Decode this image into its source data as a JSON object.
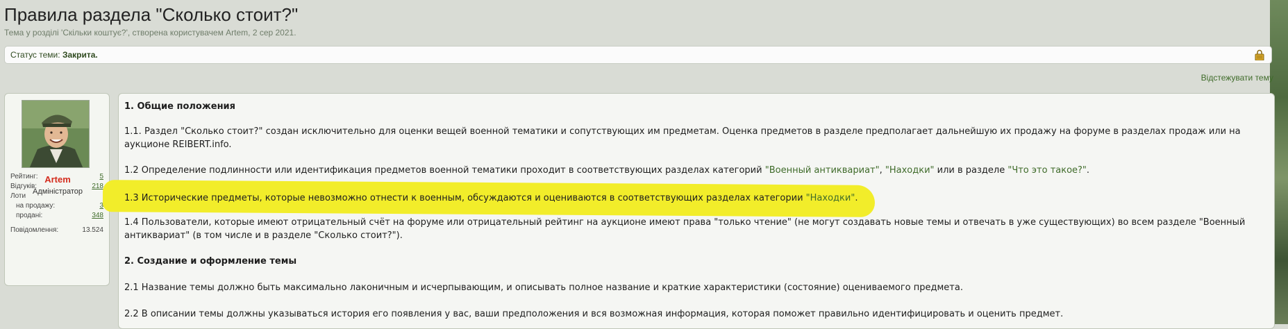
{
  "header": {
    "title": "Правила раздела \"Сколько стоит?\"",
    "subtitle": "Тема у розділі 'Скільки коштує?', створена користувачем Artem, 2 сер 2021."
  },
  "status": {
    "label": "Статус теми:",
    "value": "Закрита."
  },
  "watch_link": "Відстежувати тему",
  "user": {
    "name": "Artem",
    "role": "Адміністратор",
    "stats": {
      "rating_label": "Рейтинг:",
      "rating_value": "5",
      "reviews_label": "Відгуків:",
      "reviews_value": "218",
      "lots_label": "Лоти",
      "on_sale_label": "на продажу:",
      "on_sale_value": "3",
      "sold_label": "продані:",
      "sold_value": "348",
      "messages_label": "Повідомлення:",
      "messages_value": "13.524"
    }
  },
  "post": {
    "h1": "1. Общие положения",
    "p1_1a": "1.1. Раздел \"Сколько стоит?\" создан исключительно для оценки вещей военной тематики и сопутствующих им предметам. Оценка предметов в разделе предполагает дальнейшую их продажу на форуме в разделах продаж или на",
    "p1_1b": "аукционе REIBERT.info.",
    "p1_2_pre": "1.2 Определение подлинности или идентификация предметов военной тематики проходит в соответствующих разделах категорий ",
    "p1_2_link1": "\"Военный антиквариат\"",
    "p1_2_mid": ", ",
    "p1_2_link2": "\"Находки\"",
    "p1_2_mid2": " или в разделе ",
    "p1_2_link3": "\"Что это такое?\"",
    "p1_2_end": ".",
    "p1_3_pre": "1.3 Исторические предметы, которые невозможно отнести к военным, обсуждаются и оцениваются в соответствующих разделах категории ",
    "p1_3_link": "\"Находки\"",
    "p1_3_end": ".",
    "p1_4a": "1.4 Пользователи, которые имеют отрицательный счёт на форуме или отрицательный рейтинг на аукционе имеют права \"только чтение\" (не могут создавать новые темы и отвечать в уже существующих) во всем разделе \"Военный",
    "p1_4b": "антиквариат\" (в том числе и в разделе \"Сколько стоит?\").",
    "h2": "2. Создание и оформление темы",
    "p2_1": "2.1 Название темы должно быть максимально лаконичным и исчерпывающим, и описывать полное название и краткие характеристики (состояние) оцениваемого предмета.",
    "p2_2": "2.2 В описании темы должны указываться история его появления у вас, ваши предположения и вся возможная информация, которая поможет правильно идентифицировать и оценить предмет."
  },
  "colors": {
    "link": "#3f6b2a",
    "username": "#d42c1d",
    "highlight": "#f2ed2a"
  }
}
